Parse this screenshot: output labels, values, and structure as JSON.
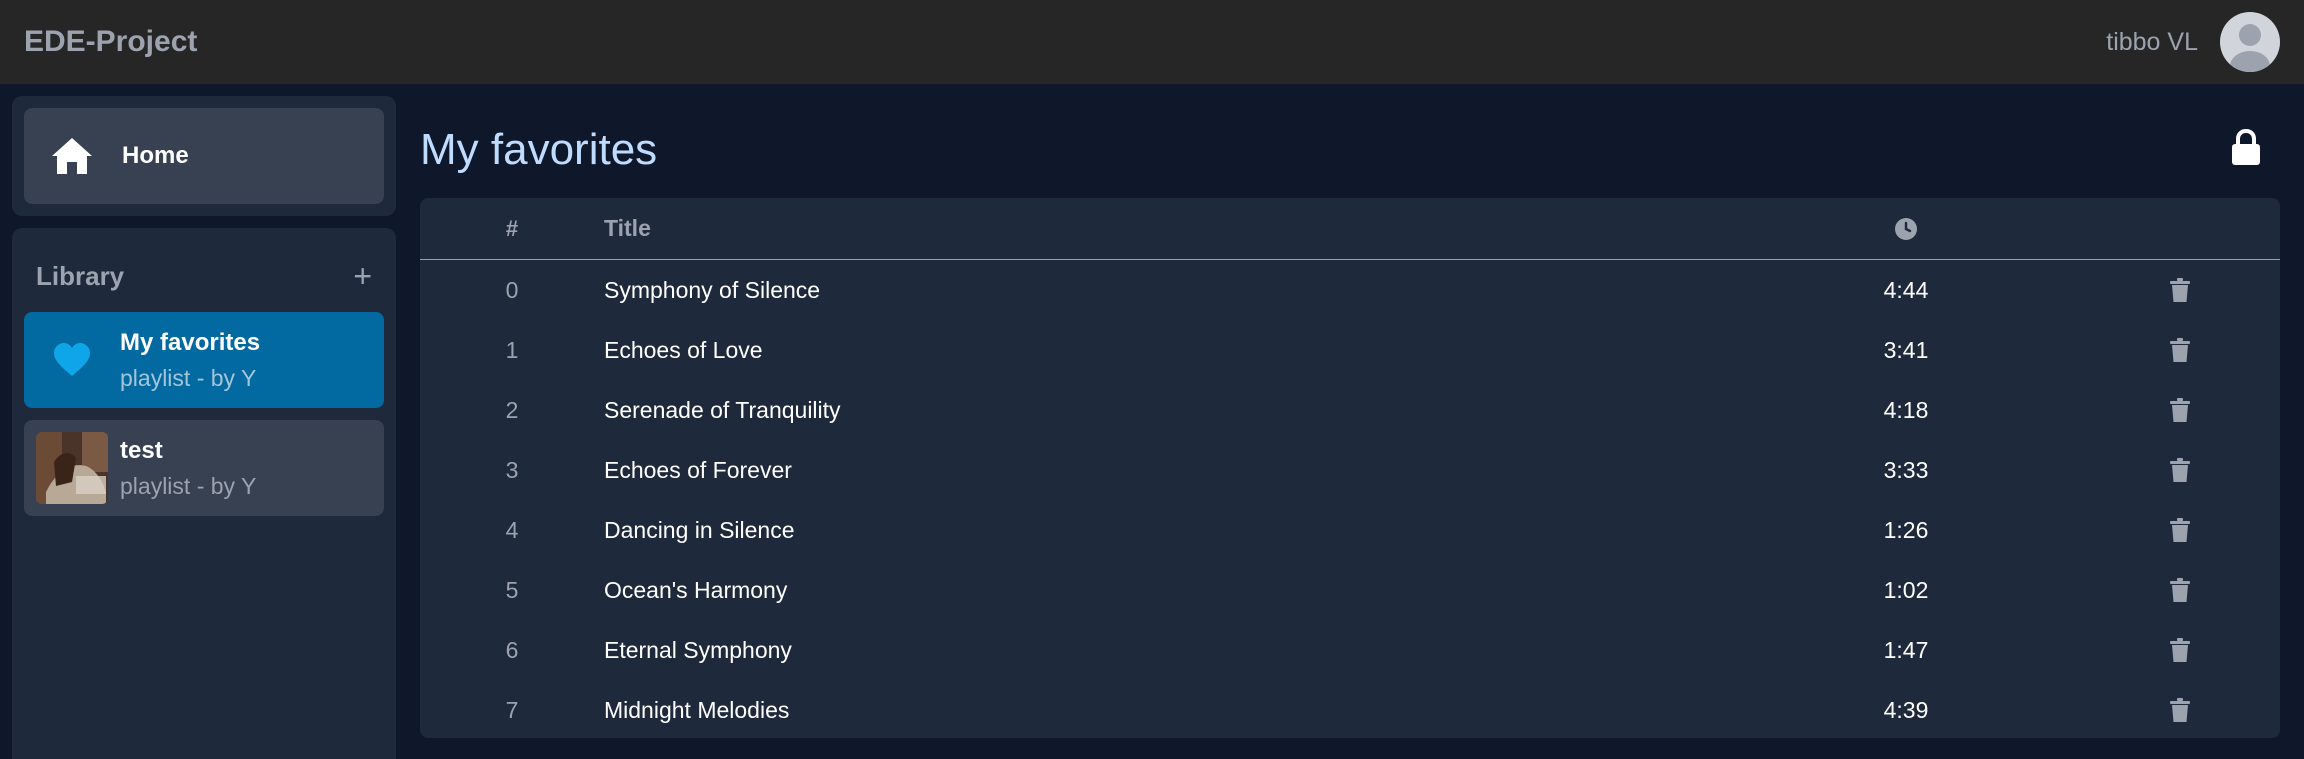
{
  "app": {
    "brand": "EDE-Project"
  },
  "user": {
    "name": "tibbo VL"
  },
  "nav": {
    "home_label": "Home"
  },
  "library": {
    "title": "Library",
    "add_symbol": "+",
    "playlists": [
      {
        "name": "My favorites",
        "subtitle": "playlist - by Y",
        "icon": "heart-icon",
        "active": true
      },
      {
        "name": "test",
        "subtitle": "playlist - by Y",
        "icon": "playlist-cover-image",
        "active": false
      }
    ]
  },
  "page": {
    "title": "My favorites"
  },
  "table": {
    "header": {
      "num": "#",
      "title": "Title",
      "duration_icon": "clock-icon"
    },
    "rows": [
      {
        "num": "0",
        "title": "Symphony of Silence",
        "duration": "4:44"
      },
      {
        "num": "1",
        "title": "Echoes of Love",
        "duration": "3:41"
      },
      {
        "num": "2",
        "title": "Serenade of Tranquility",
        "duration": "4:18"
      },
      {
        "num": "3",
        "title": "Echoes of Forever",
        "duration": "3:33"
      },
      {
        "num": "4",
        "title": "Dancing in Silence",
        "duration": "1:26"
      },
      {
        "num": "5",
        "title": "Ocean's Harmony",
        "duration": "1:02"
      },
      {
        "num": "6",
        "title": "Eternal Symphony",
        "duration": "1:47"
      },
      {
        "num": "7",
        "title": "Midnight Melodies",
        "duration": "4:39"
      }
    ]
  },
  "colors": {
    "accent": "#0369a1",
    "background": "#0f172a",
    "panel": "#1e293b",
    "topbar": "#262626",
    "title": "#bfdbfe"
  }
}
